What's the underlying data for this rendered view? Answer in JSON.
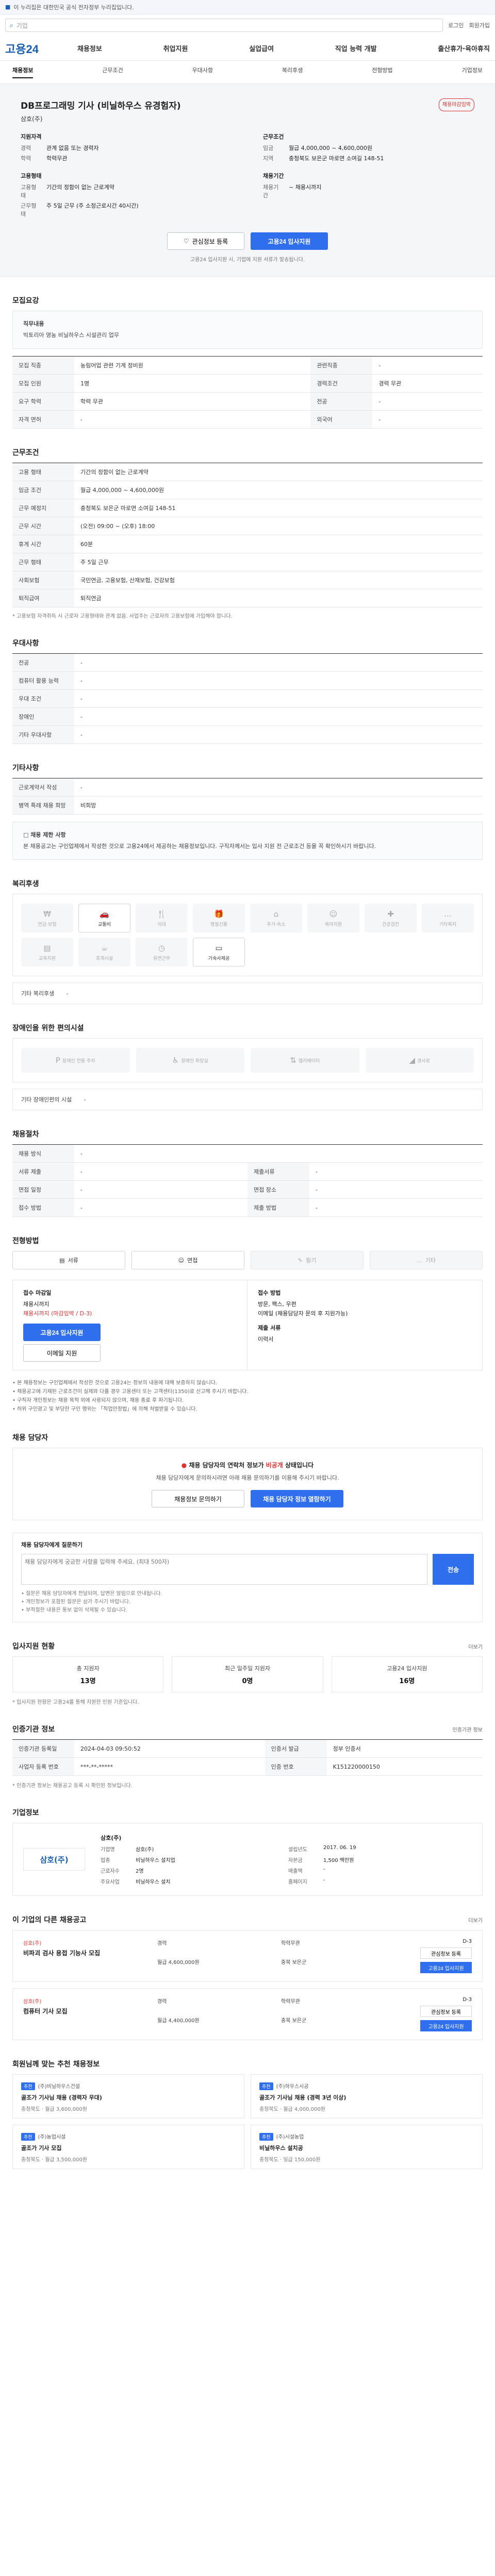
{
  "topbar": {
    "gov_label": "이 누리집은 대한민국 공식 전자정부 누리집입니다."
  },
  "search": {
    "placeholder": "기업",
    "util": [
      "로그인",
      "회원가입"
    ]
  },
  "gnb": {
    "logo": "고용24",
    "menu": [
      "채용정보",
      "취업지원",
      "실업급여",
      "직업 능력 개발",
      "출산휴가·육아휴직"
    ]
  },
  "tabs": [
    "채용정보",
    "근무조건",
    "우대사항",
    "복리후생",
    "전형방법",
    "기업정보"
  ],
  "job": {
    "title": "DB프로그래밍 기사 (비닐하우스 유경험자)",
    "badge": "채용마감임박",
    "company": "삼호(주)",
    "qual_head": "지원자격",
    "career_k": "경력",
    "career_v": "관계 없음 또는 경력자",
    "edu_k": "학력",
    "edu_v": "학력무관",
    "emp_head": "고용형태",
    "emp_k": "고용형태",
    "emp_v": "기간의 정함이 없는 근로계약",
    "worktype_k": "근무형태",
    "worktype_v": "주 5일 근무 (주 소정근로시간 40시간)",
    "cond_head": "근무조건",
    "pay_k": "임금",
    "pay_v": "월급 4,000,000 ~ 4,600,000원",
    "area_k": "지역",
    "area_v": "충청북도 보은군 마로면 소여길 148-51",
    "period_head": "채용기간",
    "period_k": "채용기간",
    "period_v": "~ 채용시까지",
    "save_btn": "관심정보 등록",
    "apply_btn": "고용24 입사지원",
    "notice": "고용24 입사지원 시, 기업에 지원 서류가 발송됩니다."
  },
  "recruit": {
    "title": "모집요강",
    "intro_head": "직무내용",
    "intro_text": "빅토리아 영농 비닐하우스 시설관리 업무",
    "rows": [
      {
        "k": "모집 직종",
        "v": "농림어업 관련 기계 정비원",
        "k2": "관련직종",
        "v2": "-"
      },
      {
        "k": "모집 인원",
        "v": "1명",
        "k2": "경력조건",
        "v2": "경력 무관"
      },
      {
        "k": "요구 학력",
        "v": "학력 무관",
        "k2": "전공",
        "v2": "-"
      },
      {
        "k": "자격 면허",
        "v": "-",
        "k2": "외국어",
        "v2": "-"
      }
    ]
  },
  "conditions": {
    "title": "근무조건",
    "rows": [
      {
        "k": "고용 형태",
        "v": "기간의 정함이 없는 근로계약"
      },
      {
        "k": "임금 조건",
        "v": "월급 4,000,000 ~ 4,600,000원"
      },
      {
        "k": "근무 예정지",
        "v": "충청북도 보은군 마로면 소여길 148-51"
      },
      {
        "k": "근무 시간",
        "v": "(오전) 09:00 ~ (오후) 18:00"
      },
      {
        "k": "휴게 시간",
        "v": "60분"
      },
      {
        "k": "근무 형태",
        "v": "주 5일 근무"
      },
      {
        "k": "사회보험",
        "v": "국민연금, 고용보험, 산재보험, 건강보험"
      },
      {
        "k": "퇴직급여",
        "v": "퇴직연금"
      }
    ],
    "note": "* 고용보험 자격취득 시 근로자 고용형태와 관계 없음. 사업주는 근로자의 고용보험에 가입해야 합니다."
  },
  "preferred": {
    "title": "우대사항",
    "rows": [
      {
        "k": "전공",
        "v": "-"
      },
      {
        "k": "컴퓨터 활용 능력",
        "v": "-"
      },
      {
        "k": "우대 조건",
        "v": "-"
      },
      {
        "k": "장애인",
        "v": "-"
      },
      {
        "k": "기타 우대사항",
        "v": "-"
      }
    ]
  },
  "etc": {
    "title": "기타사항",
    "rows": [
      {
        "k": "근로계약서 작성",
        "v": "-"
      },
      {
        "k": "병역 특례 채용 희망",
        "v": "비희망"
      }
    ],
    "warning": "□ 채용 제한 사항",
    "warning_text": "본 채용공고는 구인업체에서 작성한 것으로 고용24에서 제공하는 채용정보입니다. 구직자께서는 입사 지원 전 근로조건 등을 꼭 확인하시기 바랍니다."
  },
  "welfare": {
    "title": "복리후생",
    "items": [
      {
        "icon": "money-icon",
        "label": "연금·보험",
        "on": false
      },
      {
        "icon": "car-icon",
        "label": "교통비",
        "on": true
      },
      {
        "icon": "meal-icon",
        "label": "식대",
        "on": false
      },
      {
        "icon": "gift-icon",
        "label": "명절선물",
        "on": false
      },
      {
        "icon": "house-icon",
        "label": "주거·숙소",
        "on": false
      },
      {
        "icon": "child-icon",
        "label": "육아지원",
        "on": false
      },
      {
        "icon": "health-icon",
        "label": "건강검진",
        "on": false
      },
      {
        "icon": "other-icon",
        "label": "기타복지",
        "on": false
      },
      {
        "icon": "book-icon",
        "label": "교육지원",
        "on": false
      },
      {
        "icon": "coffee-icon",
        "label": "휴게시설",
        "on": false
      },
      {
        "icon": "clock-icon",
        "label": "유연근무",
        "on": false
      },
      {
        "icon": "bed-icon",
        "label": "기숙사제공",
        "on": true
      }
    ],
    "etc_label": "기타 복리후생",
    "etc_value": "-"
  },
  "disability": {
    "title": "장애인을 위한 편의시설",
    "items": [
      "장애인 전용 주차",
      "장애인 화장실",
      "엘리베이터",
      "경사로"
    ],
    "etc_label": "기타 장애인편의 시설",
    "etc_value": "-"
  },
  "process": {
    "title": "채용절차",
    "rows": [
      {
        "k": "채용 방식",
        "v": "-",
        "k2": "",
        "v2": ""
      },
      {
        "k": "서류 제출",
        "v": "-",
        "k2": "제출서류",
        "v2": "-"
      },
      {
        "k": "면접 일정",
        "v": "-",
        "k2": "면접 장소",
        "v2": "-"
      },
      {
        "k": "접수 방법",
        "v": "-",
        "k2": "제출 방법",
        "v2": "-"
      }
    ]
  },
  "apply": {
    "title": "전형방법",
    "opts": [
      {
        "label": "서류",
        "off": false
      },
      {
        "label": "면접",
        "off": false
      },
      {
        "label": "필기",
        "off": true
      },
      {
        "label": "기타",
        "off": true
      }
    ],
    "left_lbl": "접수 마감일",
    "left_val": "채용시까지",
    "left_red": "채용시까지 (마감임박 / D-3)",
    "apply_btn": "고용24 입사지원",
    "email_btn": "이메일 지원",
    "right_lbl": "접수 방법",
    "right_v1": "방문, 팩스, 우편",
    "right_v2": "이메일 (채용담당자 문의 후 지원가능)",
    "right_lbl2": "제출 서류",
    "right_v3": "이력서",
    "bullets": [
      "• 본 채용정보는 구인업체에서 작성한 것으로 고용24는 정보의 내용에 대해 보증하지 않습니다.",
      "• 채용공고에 기재된 근로조건이 실제와 다를 경우 고용센터 또는 고객센터(1350)로 신고해 주시기 바랍니다.",
      "• 구직자 개인정보는 채용 목적 외에 사용되지 않으며, 채용 종료 후 파기됩니다.",
      "• 허위 구인광고 및 부당한 구인 행위는 「직업안정법」에 의해 처벌받을 수 있습니다."
    ]
  },
  "manager": {
    "title": "채용 담당자",
    "warn_prefix": "채용 담당자의 연락처 정보가 ",
    "warn_red": "비공개",
    "warn_suffix": " 상태입니다",
    "desc": "채용 담당자에게 문의하시려면 아래 채용 문의하기를 이용해 주시기 바랍니다.",
    "btn1": "채용정보 문의하기",
    "btn2": "채용 담당자 정보 열람하기",
    "inq_title": "채용 담당자에게 질문하기",
    "inq_placeholder": "채용 담당자에게 궁금한 사항을 입력해 주세요. (최대 500자)",
    "send": "전송",
    "inq_notes": [
      "• 질문은 채용 담당자에게 전달되며, 답변은 알림으로 안내됩니다.",
      "• 개인정보가 포함된 질문은 삼가 주시기 바랍니다.",
      "• 부적절한 내용은 통보 없이 삭제될 수 있습니다."
    ]
  },
  "status": {
    "title": "입사지원 현황",
    "more": "더보기",
    "items": [
      {
        "label": "총 지원자",
        "num": "13명"
      },
      {
        "label": "최근 일주일 지원자",
        "num": "0명"
      },
      {
        "label": "고용24 입사지원",
        "num": "16명"
      }
    ],
    "note": "* 입사지원 현황은 고용24를 통해 지원한 인원 기준입니다."
  },
  "agency": {
    "title": "인증기관 정보",
    "more": "인증기관 정보",
    "rows": [
      {
        "k": "인증기관 등록일",
        "v": "2024-04-03 09:50:52",
        "k2": "인증서 발급",
        "v2": "정부 인증서"
      },
      {
        "k": "사업자 등록 번호",
        "v": "***-**-*****",
        "k2": "인증 번호",
        "v2": "K151220000150"
      }
    ],
    "note": "* 인증기관 정보는 채용공고 등록 시 확인된 정보입니다."
  },
  "company": {
    "title": "기업정보",
    "logo": "삼호(주)",
    "name": "삼호(주)",
    "info": [
      {
        "k": "기업명",
        "v": "삼호(주)"
      },
      {
        "k": "설립년도",
        "v": "2017. 06. 19"
      },
      {
        "k": "업종",
        "v": "비닐하우스 설치업"
      },
      {
        "k": "자본금",
        "v": "1,500 백만원"
      },
      {
        "k": "근로자수",
        "v": "2명"
      },
      {
        "k": "매출액",
        "v": "-"
      },
      {
        "k": "주요사업",
        "v": "비닐하우스 설치"
      },
      {
        "k": "홈페이지",
        "v": "-"
      }
    ]
  },
  "related": {
    "title": "이 기업의 다른 채용공고",
    "more": "더보기",
    "items": [
      {
        "cname": "삼호(주)",
        "title": "비파괴 검사 용접 기능사 모집",
        "meta": [
          "경력",
          "학력무관",
          "월급 4,600,000원",
          "충북 보은군"
        ],
        "d": "D-3",
        "btn1": "관심정보 등록",
        "btn2": "고용24 입사지원"
      },
      {
        "cname": "삼호(주)",
        "title": "컴퓨터 기사 모집",
        "meta": [
          "경력",
          "학력무관",
          "월급 4,400,000원",
          "충북 보은군"
        ],
        "d": "D-3",
        "btn1": "관심정보 등록",
        "btn2": "고용24 입사지원"
      }
    ]
  },
  "recommend": {
    "title": "회원님께 맞는 추천 채용정보",
    "items": [
      {
        "tag": "추천",
        "cname": "(주)비닐하우스건설",
        "title": "골조가 기사님 채용 (경력자 우대)",
        "meta": "충청북도 · 월급 3,600,000원"
      },
      {
        "tag": "추천",
        "cname": "(주)하우스시공",
        "title": "골조가 기사님 채용 (경력 3년 이상)",
        "meta": "충청북도 · 월급 4,000,000원"
      },
      {
        "tag": "추천",
        "cname": "(주)농업시설",
        "title": "골조가 기사 모집",
        "meta": "충청북도 · 월급 3,500,000원"
      },
      {
        "tag": "추천",
        "cname": "(주)시설농업",
        "title": "비닐하우스 설치공",
        "meta": "충청북도 · 일급 150,000원"
      }
    ]
  },
  "colors": {
    "primary": "#2f6fed",
    "brand": "#1a5fb4",
    "alert": "#e03131"
  }
}
